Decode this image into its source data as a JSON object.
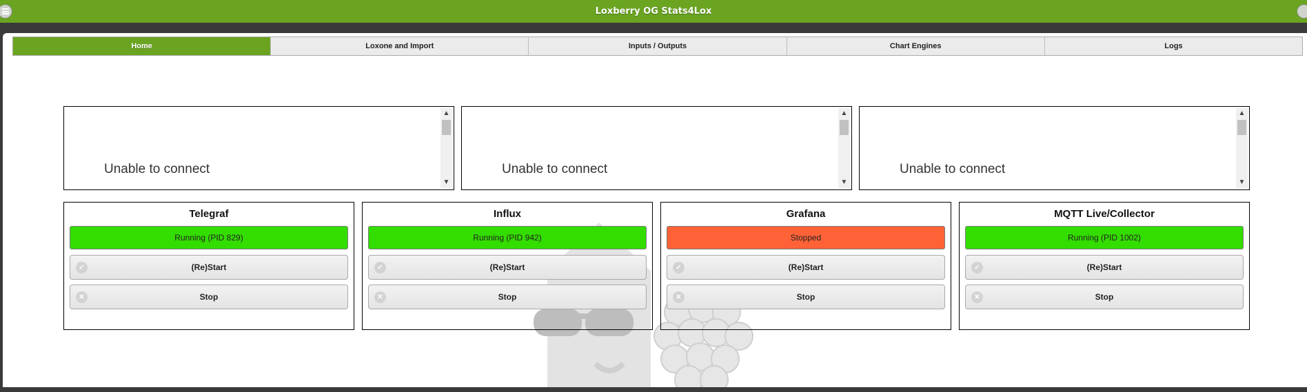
{
  "header": {
    "title": "Loxberry OG Stats4Lox"
  },
  "tabs": [
    {
      "label": "Home",
      "active": true
    },
    {
      "label": "Loxone and Import",
      "active": false
    },
    {
      "label": "Inputs / Outputs",
      "active": false
    },
    {
      "label": "Chart Engines",
      "active": false
    },
    {
      "label": "Logs",
      "active": false
    }
  ],
  "panels": [
    {
      "message": "Unable to connect"
    },
    {
      "message": "Unable to connect"
    },
    {
      "message": "Unable to connect"
    }
  ],
  "services": [
    {
      "name": "Telegraf",
      "status": "Running (PID 829)",
      "status_color": "#33dd00",
      "restart_label": "(Re)Start",
      "stop_label": "Stop"
    },
    {
      "name": "Influx",
      "status": "Running (PID 942)",
      "status_color": "#33dd00",
      "restart_label": "(Re)Start",
      "stop_label": "Stop"
    },
    {
      "name": "Grafana",
      "status": "Stopped",
      "status_color": "#ff6237",
      "restart_label": "(Re)Start",
      "stop_label": "Stop"
    },
    {
      "name": "MQTT Live/Collector",
      "status": "Running (PID 1002)",
      "status_color": "#33dd00",
      "restart_label": "(Re)Start",
      "stop_label": "Stop"
    }
  ],
  "colors": {
    "brand": "#6aa421",
    "background": "#3a3a3a"
  },
  "icons": {
    "menu": "menu-icon",
    "restart": "check-circle-icon",
    "stop": "x-circle-icon"
  }
}
